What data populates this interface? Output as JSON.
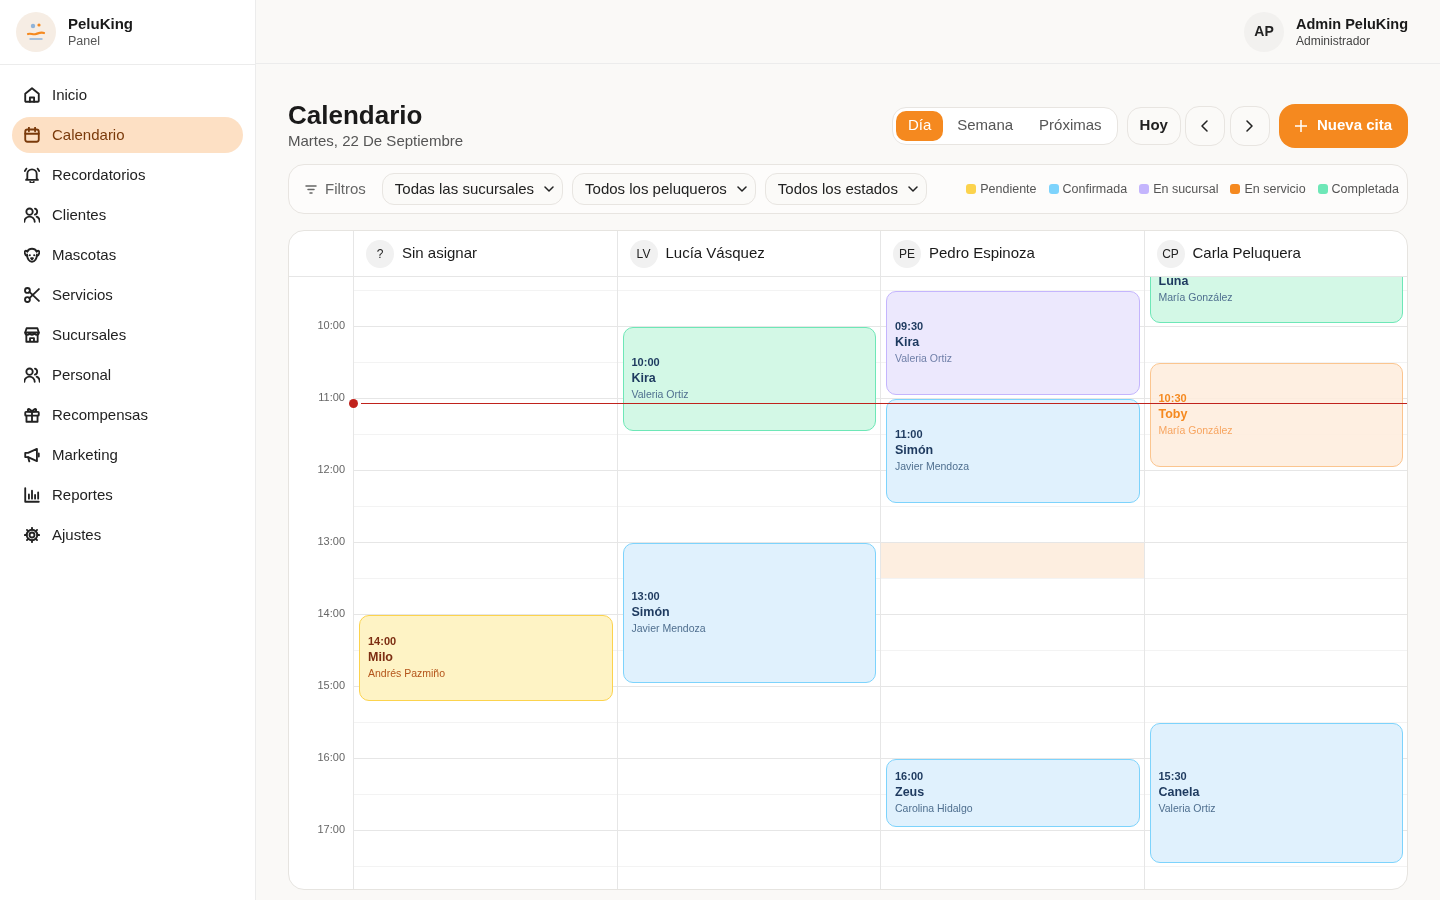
{
  "sidebar": {
    "brand": {
      "name": "PeluKing",
      "subtitle": "Panel"
    },
    "items": [
      {
        "label": "Inicio",
        "selected": false
      },
      {
        "label": "Calendario",
        "selected": true
      },
      {
        "label": "Recordatorios",
        "selected": false
      },
      {
        "label": "Clientes",
        "selected": false
      },
      {
        "label": "Mascotas",
        "selected": false
      },
      {
        "label": "Servicios",
        "selected": false
      },
      {
        "label": "Sucursales",
        "selected": false
      },
      {
        "label": "Personal",
        "selected": false
      },
      {
        "label": "Recompensas",
        "selected": false
      },
      {
        "label": "Marketing",
        "selected": false
      },
      {
        "label": "Reportes",
        "selected": false
      },
      {
        "label": "Ajustes",
        "selected": false
      }
    ]
  },
  "topbar": {
    "user": {
      "initials": "AP",
      "name": "Admin PeluKing",
      "role": "Administrador"
    }
  },
  "header": {
    "title": "Calendario",
    "date": "Martes, 22 De Septiembre",
    "view_tabs": [
      {
        "label": "Día",
        "selected": true
      },
      {
        "label": "Semana",
        "selected": false
      },
      {
        "label": "Próximas",
        "selected": false
      }
    ],
    "today_button": "Hoy",
    "new_button": "Nueva cita"
  },
  "filters": {
    "label": "Filtros",
    "selects": [
      "Todas las sucursales",
      "Todos los peluqueros",
      "Todos los estados"
    ],
    "legend": [
      {
        "label": "Pendiente",
        "color": "#fcd34d"
      },
      {
        "label": "Confirmada",
        "color": "#7dd3fc"
      },
      {
        "label": "En sucursal",
        "color": "#c4b5fd"
      },
      {
        "label": "En servicio",
        "color": "#f5891f"
      },
      {
        "label": "Completada",
        "color": "#6ee7b7"
      }
    ]
  },
  "calendar": {
    "now_indicator": true,
    "hours": [
      "10:00",
      "11:00",
      "12:00",
      "13:00",
      "14:00",
      "15:00",
      "16:00",
      "17:00"
    ],
    "columns": [
      {
        "initials": "?",
        "name": "Sin asignar",
        "events": [
          {
            "kind": "appointment",
            "time": "14:00",
            "pet": "Milo",
            "client": "Andrés Pazmiño",
            "color": "#fcd34d"
          }
        ]
      },
      {
        "initials": "LV",
        "name": "Lucía Vásquez",
        "events": [
          {
            "kind": "appointment",
            "time": "10:00",
            "pet": "Kira",
            "client": "Valeria Ortiz",
            "color": "#6ee7b7"
          },
          {
            "kind": "appointment",
            "time": "13:00",
            "pet": "Simón",
            "client": "Javier Mendoza",
            "color": "#7dd3fc"
          }
        ]
      },
      {
        "initials": "PE",
        "name": "Pedro Espinoza",
        "events": [
          {
            "kind": "appointment",
            "time": "09:30",
            "pet": "Kira",
            "client": "Valeria Ortiz",
            "color": "#c4b5fd"
          },
          {
            "kind": "appointment",
            "time": "11:00",
            "pet": "Simón",
            "client": "Javier Mendoza",
            "color": "#7dd3fc"
          },
          {
            "kind": "break"
          },
          {
            "kind": "appointment",
            "time": "16:00",
            "pet": "Zeus",
            "client": "Carolina Hidalgo",
            "color": "#7dd3fc"
          }
        ]
      },
      {
        "initials": "CP",
        "name": "Carla Peluquera",
        "events": [
          {
            "kind": "appointment",
            "pet": "Luna",
            "client": "María González",
            "color": "#6ee7b7"
          },
          {
            "kind": "appointment",
            "time": "10:30",
            "pet": "Toby",
            "client": "María González",
            "color": "#f5891f"
          },
          {
            "kind": "appointment",
            "time": "15:30",
            "pet": "Canela",
            "client": "Valeria Ortiz",
            "color": "#7dd3fc"
          }
        ]
      }
    ]
  }
}
